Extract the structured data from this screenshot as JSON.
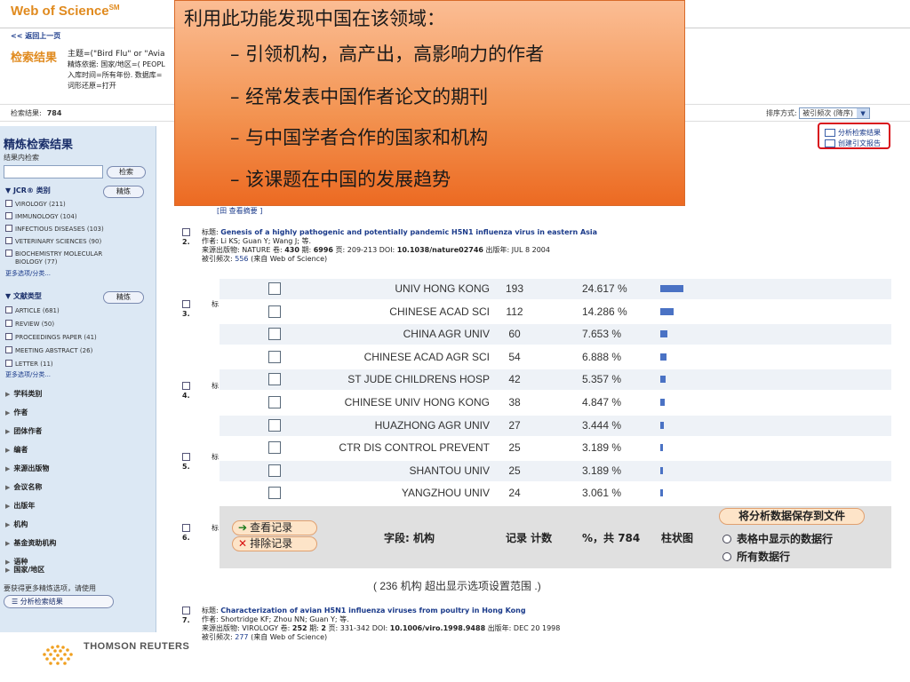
{
  "header": {
    "logo": "Web of Science",
    "logo_mark": "SM"
  },
  "nav": {
    "back": "<< 返回上一页"
  },
  "results": {
    "label": "检索结果",
    "query_topic": "主题=(\"Bird Flu\" or \"Avia",
    "query_refined": "精炼依据: 国家/地区=( PEOPL",
    "query_timespan": "入库时间=所有年份. 数据库=",
    "query_lemma": "词形还原=打开",
    "count_label": "检索结果:",
    "count": "784"
  },
  "sort": {
    "label": "排序方式:",
    "value": "被引频次 (降序)"
  },
  "right_links": {
    "analyze": "分析检索结果",
    "citation_report": "创建引文报告"
  },
  "sidebar": {
    "title": "精炼检索结果",
    "within_label": "结果内检索",
    "search_button": "检索",
    "refine_button": "精炼",
    "jcr_head": "JCR® 类别",
    "jcr_items": [
      "VIROLOGY (211)",
      "IMMUNOLOGY (104)",
      "INFECTIOUS DISEASES (103)",
      "VETERINARY SCIENCES (90)",
      "BIOCHEMISTRY MOLECULAR",
      "BIOLOGY (77)"
    ],
    "more_options": "更多选项/分类...",
    "doctype_head": "文献类型",
    "doctype_items": [
      "ARTICLE (681)",
      "REVIEW (50)",
      "PROCEEDINGS PAPER (41)",
      "MEETING ABSTRACT (26)",
      "LETTER (11)"
    ],
    "categories": [
      "学科类别",
      "作者",
      "团体作者",
      "编者",
      "来源出版物",
      "会议名称",
      "出版年",
      "机构",
      "基金资助机构",
      "语种",
      "国家/地区"
    ],
    "note": "要获得更多精炼选项，请使用",
    "analyze_button": "分析检索结果"
  },
  "overlay": {
    "heading": "利用此功能发现中国在该领域：",
    "bullets": [
      "– 引领机构，高产出，高影响力的作者",
      "– 经常发表中国作者论文的期刊",
      "– 与中国学者合作的国家和机构",
      "– 该课题在中国的发展趋势"
    ]
  },
  "records": {
    "rec1_view_abstract": "[田 查看摘要 ]",
    "rec2": {
      "num": "2.",
      "title_label": "标题:",
      "title": "Genesis of a highly pathogenic and potentially pandemic H5N1 influenza virus in eastern Asia",
      "authors": "作者: Li KS; Guan Y; Wang J; 等.",
      "source_prefix": "来源出版物: NATURE 卷:",
      "volume": "430",
      "issue_label": "期:",
      "issue": "6996",
      "pages": "页: 209-213  DOI:",
      "doi": "10.1038/nature02746",
      "pubyear": "出版年: JUL 8 2004",
      "cited_label": "被引频次:",
      "cited": "556",
      "cited_src": "(来自 Web of Science)"
    },
    "rec7": {
      "num": "7.",
      "title_label": "标题:",
      "title": "Characterization of avian H5N1 influenza viruses from poultry in Hong Kong",
      "authors": "作者: Shortridge KF; Zhou NN; Guan Y; 等.",
      "source_prefix": "来源出版物: VIROLOGY 卷:",
      "volume": "252",
      "issue_label": "期:",
      "issue": "2",
      "pages": "页: 331-342  DOI:",
      "doi": "10.1006/viro.1998.9488",
      "pubyear": "出版年: DEC 20 1998",
      "cited_label": "被引频次:",
      "cited": "277",
      "cited_src": "(来自 Web of Science)"
    },
    "stub_nums": [
      "3.",
      "4.",
      "5.",
      "6."
    ],
    "stub_label": "标"
  },
  "analysis_table": {
    "rows": [
      {
        "org": "UNIV HONG KONG",
        "count": 193,
        "pct": "24.617 %"
      },
      {
        "org": "CHINESE ACAD SCI",
        "count": 112,
        "pct": "14.286 %"
      },
      {
        "org": "CHINA AGR UNIV",
        "count": 60,
        "pct": "7.653 %"
      },
      {
        "org": "CHINESE ACAD AGR SCI",
        "count": 54,
        "pct": "6.888 %"
      },
      {
        "org": "ST JUDE CHILDRENS HOSP",
        "count": 42,
        "pct": "5.357 %"
      },
      {
        "org": "CHINESE UNIV HONG KONG",
        "count": 38,
        "pct": "4.847 %"
      },
      {
        "org": "HUAZHONG AGR UNIV",
        "count": 27,
        "pct": "3.444 %"
      },
      {
        "org": "CTR DIS CONTROL PREVENT",
        "count": 25,
        "pct": "3.189 %"
      },
      {
        "org": "SHANTOU UNIV",
        "count": 25,
        "pct": "3.189 %"
      },
      {
        "org": "YANGZHOU UNIV",
        "count": 24,
        "pct": "3.061 %"
      }
    ],
    "view_records": "查看记录",
    "remove_records": "排除记录",
    "col_field": "字段: 机构",
    "col_count": "记录 计数",
    "col_pct": "%，共 784",
    "col_bar": "柱状图",
    "save_button": "将分析数据保存到文件",
    "option_shown": "表格中显示的数据行",
    "option_all": "所有数据行",
    "range_note": "( 236 机构 超出显示选项设置范围 .)",
    "bar_color": "#4a72c4"
  },
  "footer": {
    "brand": "THOMSON REUTERS"
  }
}
